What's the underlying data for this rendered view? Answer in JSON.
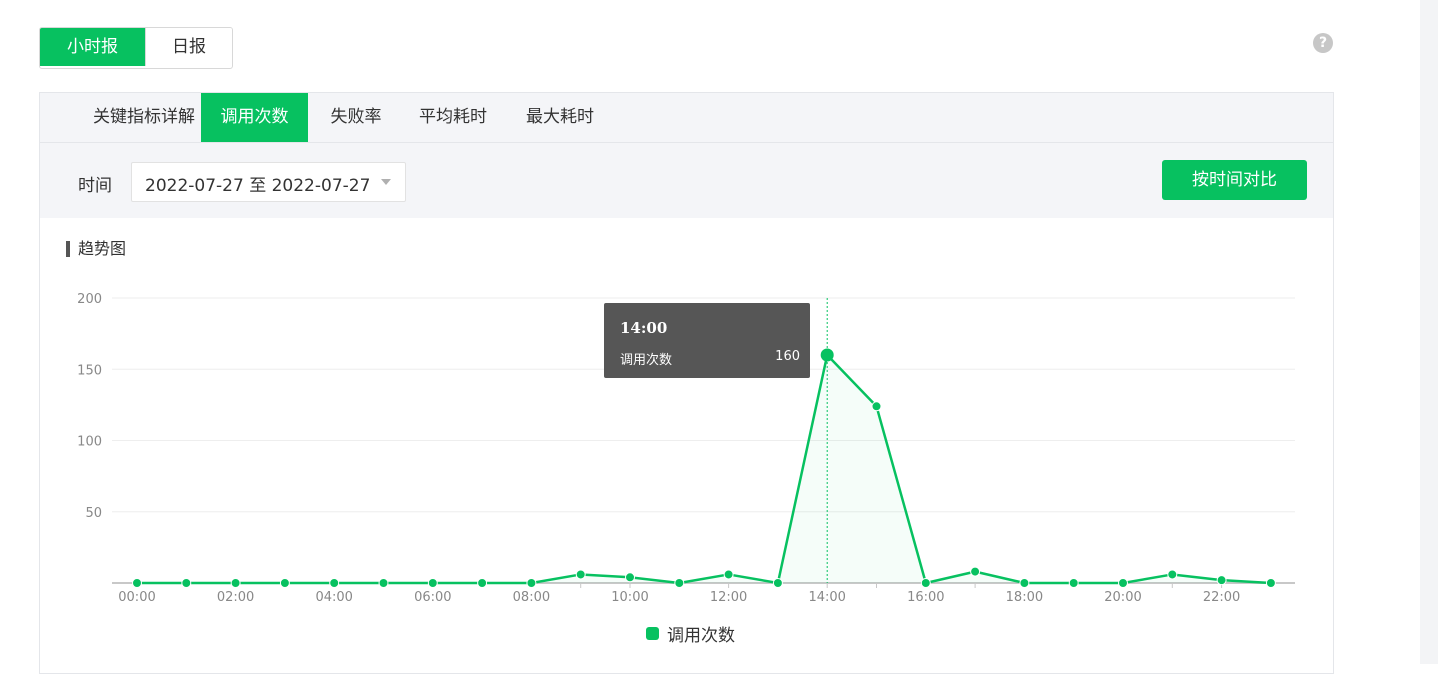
{
  "period_toggle": {
    "hourly": "小时报",
    "daily": "日报"
  },
  "help": {
    "glyph": "?"
  },
  "tabs": [
    {
      "label": "关键指标详解",
      "active": false
    },
    {
      "label": "调用次数",
      "active": true
    },
    {
      "label": "失败率",
      "active": false
    },
    {
      "label": "平均耗时",
      "active": false
    },
    {
      "label": "最大耗时",
      "active": false
    }
  ],
  "filter": {
    "time_label": "时间",
    "date_range": "2022-07-27 至 2022-07-27",
    "compare_button": "按时间对比"
  },
  "section_title": "趋势图",
  "tooltip": {
    "title": "14:00",
    "series": "调用次数",
    "value": "160"
  },
  "colors": {
    "accent": "#07c160"
  },
  "chart_data": {
    "type": "line",
    "x": [
      "00:00",
      "01:00",
      "02:00",
      "03:00",
      "04:00",
      "05:00",
      "06:00",
      "07:00",
      "08:00",
      "09:00",
      "10:00",
      "11:00",
      "12:00",
      "13:00",
      "14:00",
      "15:00",
      "16:00",
      "17:00",
      "18:00",
      "19:00",
      "20:00",
      "21:00",
      "22:00",
      "23:00"
    ],
    "tick_labels": [
      "00:00",
      "02:00",
      "04:00",
      "06:00",
      "08:00",
      "10:00",
      "12:00",
      "14:00",
      "16:00",
      "18:00",
      "20:00",
      "22:00"
    ],
    "series": [
      {
        "name": "调用次数",
        "values": [
          0,
          0,
          0,
          0,
          0,
          0,
          0,
          0,
          0,
          6,
          4,
          0,
          6,
          0,
          160,
          124,
          0,
          8,
          0,
          0,
          0,
          6,
          2,
          0
        ]
      }
    ],
    "yticks": [
      50,
      100,
      150,
      200
    ],
    "ylim": [
      0,
      200
    ],
    "highlight_index": 14,
    "grid": true,
    "legend": "bottom-center"
  }
}
